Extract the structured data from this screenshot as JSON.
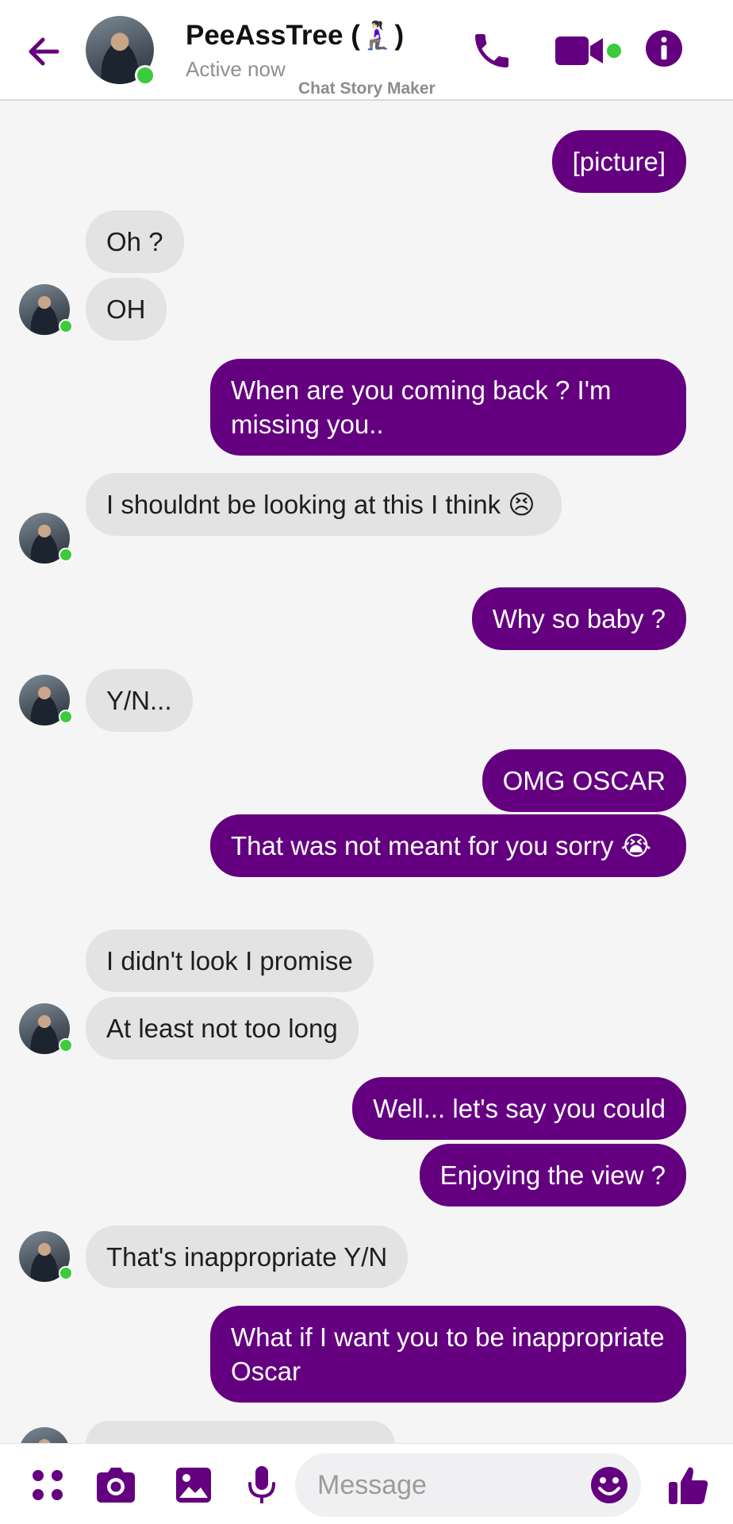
{
  "header": {
    "contact_name": "PeeAssTree (🧎🏻‍♀️)",
    "status": "Active now",
    "watermark": "Chat Story Maker"
  },
  "colors": {
    "accent": "#640080",
    "received_bubble": "#e3e3e3",
    "online": "#3ccb3c",
    "background": "#f5f5f6"
  },
  "icons": {
    "back": "arrow-left-icon",
    "call": "phone-icon",
    "video": "video-camera-icon",
    "info": "info-icon",
    "apps": "apps-grid-icon",
    "camera": "camera-icon",
    "gallery": "image-icon",
    "mic": "microphone-icon",
    "emoji": "smiley-icon",
    "like": "thumbs-up-icon"
  },
  "messages": [
    {
      "from": "me",
      "text": "[picture]"
    },
    {
      "from": "them",
      "text": "Oh ?"
    },
    {
      "from": "them",
      "text": "OH"
    },
    {
      "from": "me",
      "text": "When are you coming back ? I'm missing you.."
    },
    {
      "from": "them",
      "text": "I shouldnt be looking at this I think 😣"
    },
    {
      "from": "me",
      "text": "Why so baby ?"
    },
    {
      "from": "them",
      "text": "Y/N..."
    },
    {
      "from": "me",
      "text": "OMG OSCAR"
    },
    {
      "from": "me",
      "text": "That was not meant for you sorry 😭"
    },
    {
      "from": "them",
      "text": "I didn't look I promise"
    },
    {
      "from": "them",
      "text": "At least not too long"
    },
    {
      "from": "me",
      "text": "Well... let's say you could"
    },
    {
      "from": "me",
      "text": "Enjoying the view ?"
    },
    {
      "from": "them",
      "text": "That's inappropriate Y/N"
    },
    {
      "from": "me",
      "text": "What if I want you to be inappropriate Oscar"
    }
  ],
  "composer": {
    "placeholder": "Message"
  }
}
